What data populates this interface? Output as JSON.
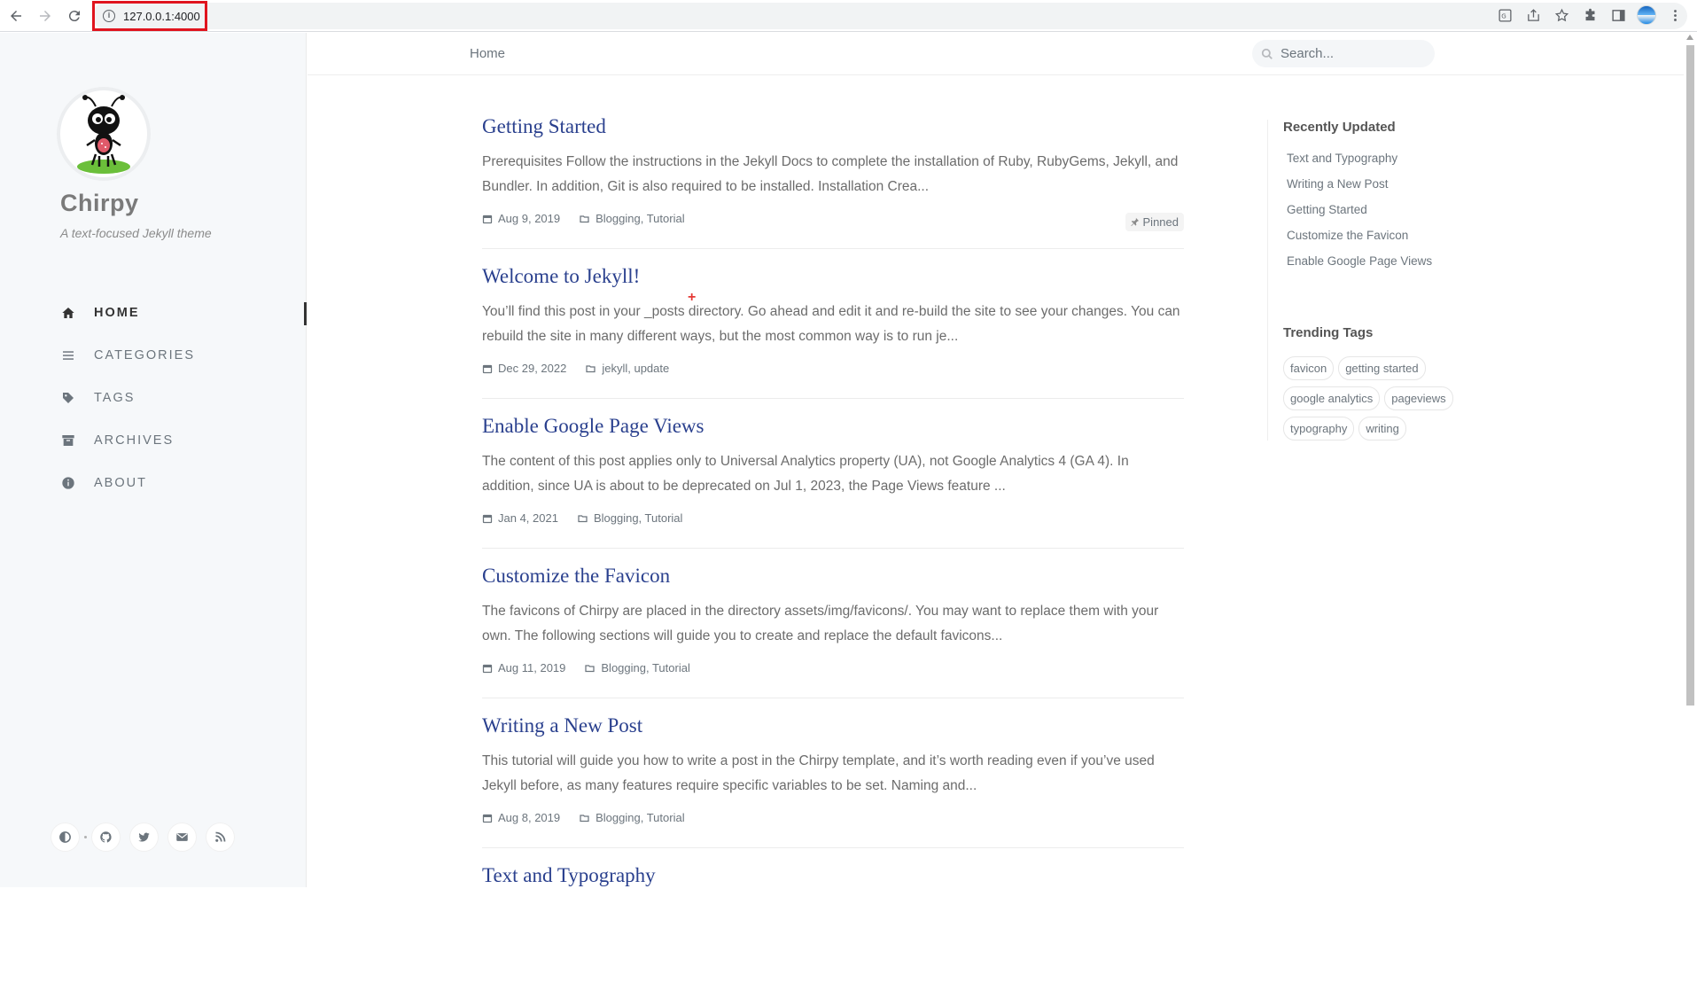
{
  "browser": {
    "url": "127.0.0.1:4000"
  },
  "sidebar": {
    "site_title": "Chirpy",
    "site_subtitle": "A text-focused Jekyll theme",
    "nav": [
      {
        "label": "HOME",
        "icon": "home-icon",
        "active": true
      },
      {
        "label": "CATEGORIES",
        "icon": "stream-icon"
      },
      {
        "label": "TAGS",
        "icon": "tag-icon"
      },
      {
        "label": "ARCHIVES",
        "icon": "archive-icon"
      },
      {
        "label": "ABOUT",
        "icon": "info-circle-icon"
      }
    ],
    "social": [
      "mode-toggle-icon",
      "github-icon",
      "twitter-icon",
      "email-icon",
      "rss-icon"
    ]
  },
  "topbar": {
    "breadcrumb": "Home",
    "search_placeholder": "Search..."
  },
  "posts": [
    {
      "title": "Getting Started",
      "excerpt": "Prerequisites Follow the instructions in the Jekyll Docs to complete the installation of Ruby, RubyGems, Jekyll, and Bundler. In addition, Git is also required to be installed. Installation Crea...",
      "date": "Aug 9, 2019",
      "categories": "Blogging, Tutorial",
      "pinned": "Pinned"
    },
    {
      "title": "Welcome to Jekyll!",
      "excerpt": "You’ll find this post in your _posts directory. Go ahead and edit it and re-build the site to see your changes. You can rebuild the site in many different ways, but the most common way is to run je...",
      "date": "Dec 29, 2022",
      "categories": "jekyll, update"
    },
    {
      "title": "Enable Google Page Views",
      "excerpt": "The content of this post applies only to Universal Analytics property (UA), not Google Analytics 4 (GA 4). In addition, since UA is about to be deprecated on Jul 1, 2023, the Page Views feature ...",
      "date": "Jan 4, 2021",
      "categories": "Blogging, Tutorial"
    },
    {
      "title": "Customize the Favicon",
      "excerpt": "The favicons of Chirpy are placed in the directory assets/img/favicons/. You may want to replace them with your own. The following sections will guide you to create and replace the default favicons...",
      "date": "Aug 11, 2019",
      "categories": "Blogging, Tutorial"
    },
    {
      "title": "Writing a New Post",
      "excerpt": "This tutorial will guide you how to write a post in the Chirpy template, and it’s worth reading even if you’ve used Jekyll before, as many features require specific variables to be set. Naming and...",
      "date": "Aug 8, 2019",
      "categories": "Blogging, Tutorial"
    },
    {
      "title": "Text and Typography",
      "excerpt": "",
      "date": "",
      "categories": ""
    }
  ],
  "panel": {
    "recent_title": "Recently Updated",
    "recent": [
      "Text and Typography",
      "Writing a New Post",
      "Getting Started",
      "Customize the Favicon",
      "Enable Google Page Views"
    ],
    "trending_title": "Trending Tags",
    "tags": [
      "favicon",
      "getting started",
      "google analytics",
      "pageviews",
      "typography",
      "writing"
    ]
  },
  "colors": {
    "post_title": "#2a408e",
    "url_highlight": "#e0141e"
  }
}
